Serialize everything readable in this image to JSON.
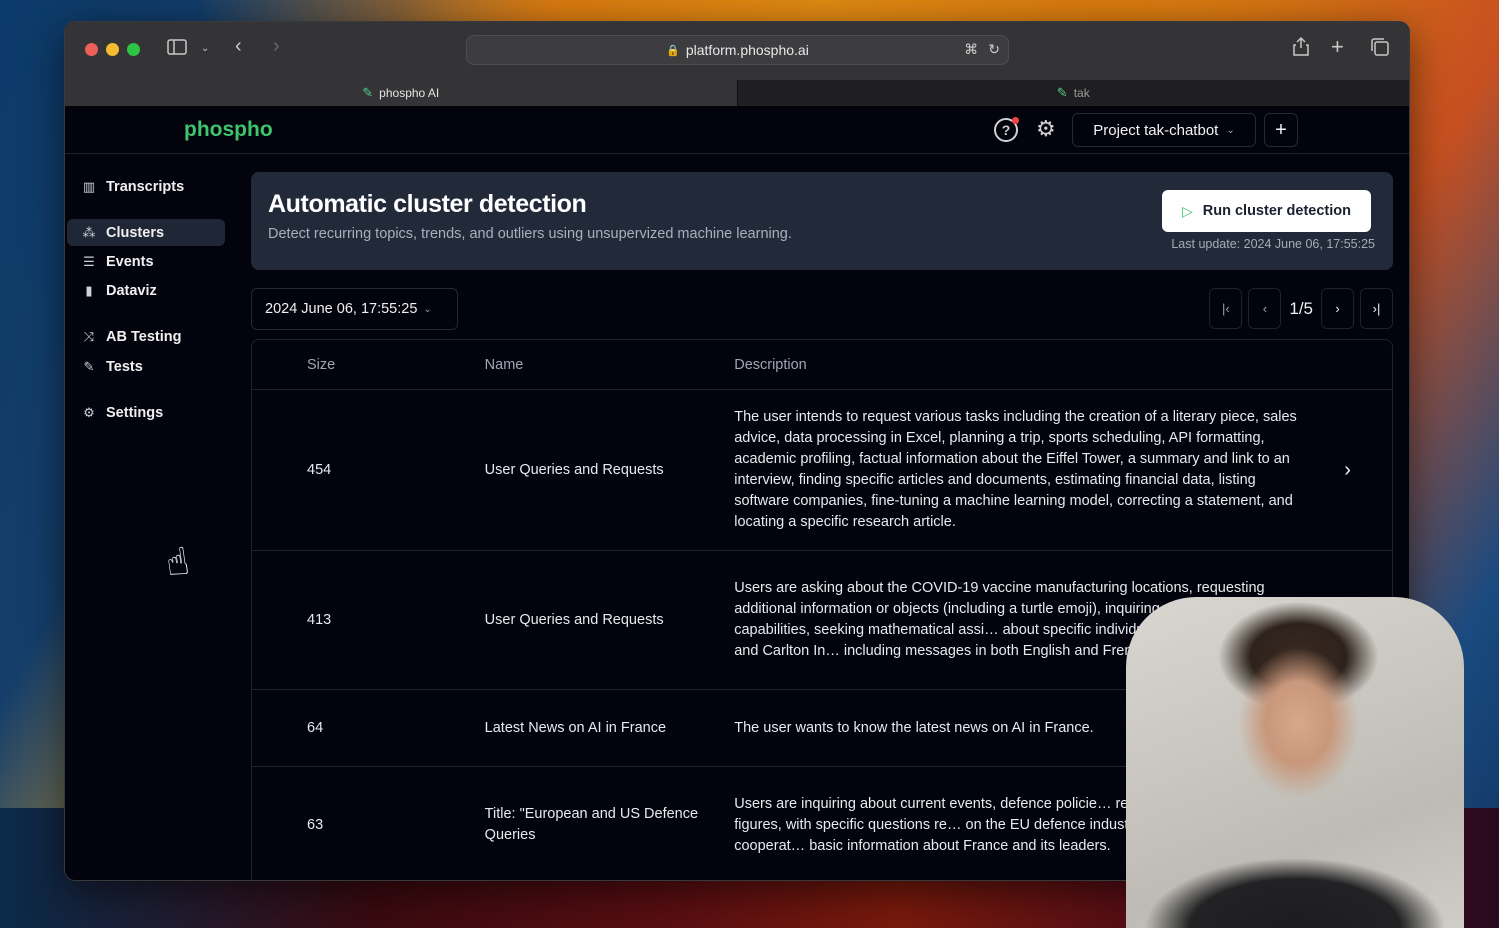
{
  "browser": {
    "url": "platform.phospho.ai",
    "tabs": [
      {
        "label": "phospho AI",
        "active": true
      },
      {
        "label": "tak",
        "active": false
      }
    ]
  },
  "header": {
    "logo": "phospho",
    "project_label": "Project tak-chatbot",
    "add_label": "+",
    "help_icon": "?",
    "brand_color": "#3ec46d"
  },
  "sidebar": {
    "items": [
      {
        "label": "Transcripts",
        "icon": "book-icon",
        "active": false
      },
      {
        "label": "Clusters",
        "icon": "clusters-icon",
        "active": true
      },
      {
        "label": "Events",
        "icon": "events-icon",
        "active": false
      },
      {
        "label": "Dataviz",
        "icon": "chart-icon",
        "active": false
      },
      {
        "label": "AB Testing",
        "icon": "shuffle-icon",
        "active": false
      },
      {
        "label": "Tests",
        "icon": "test-tube-icon",
        "active": false
      },
      {
        "label": "Settings",
        "icon": "gear-icon",
        "active": false
      }
    ]
  },
  "hero": {
    "title": "Automatic cluster detection",
    "subtitle": "Detect recurring topics, trends, and outliers using unsupervized machine learning.",
    "run_button": "Run cluster detection",
    "last_update": "Last update: 2024 June 06, 17:55:25"
  },
  "controls": {
    "selected_run": "2024 June 06, 17:55:25",
    "page": "1/5"
  },
  "table": {
    "columns": [
      "Size",
      "Name",
      "Description"
    ],
    "rows": [
      {
        "size": "454",
        "name": "User Queries and Requests",
        "description": "The user intends to request various tasks including the creation of a literary piece, sales advice, data processing in Excel, planning a trip, sports scheduling, API formatting, academic profiling, factual information about the Eiffel Tower, a summary and link to an interview, finding specific articles and documents, estimating financial data, listing software companies, fine-tuning a machine learning model, correcting a statement, and locating a specific research article."
      },
      {
        "size": "413",
        "name": "User Queries and Requests",
        "description": "Users are asking about the COVID-19 vaccine manufacturing locations, requesting additional information or objects (including a turtle emoji), inquiring about the assistant's capabilities, seeking mathematical assi… about specific individuals (Frédéric Legrand and Carlton In… including messages in both English and French."
      },
      {
        "size": "64",
        "name": "Latest News on AI in France",
        "description": "The user wants to know the latest news on AI in France."
      },
      {
        "size": "63",
        "name": "Title: \"European and US Defence Queries",
        "description": "Users are inquiring about current events, defence policie… relations, and political figures, with specific questions re… on the EU defence industry, European defence cooperat… basic information about France and its leaders."
      }
    ]
  }
}
